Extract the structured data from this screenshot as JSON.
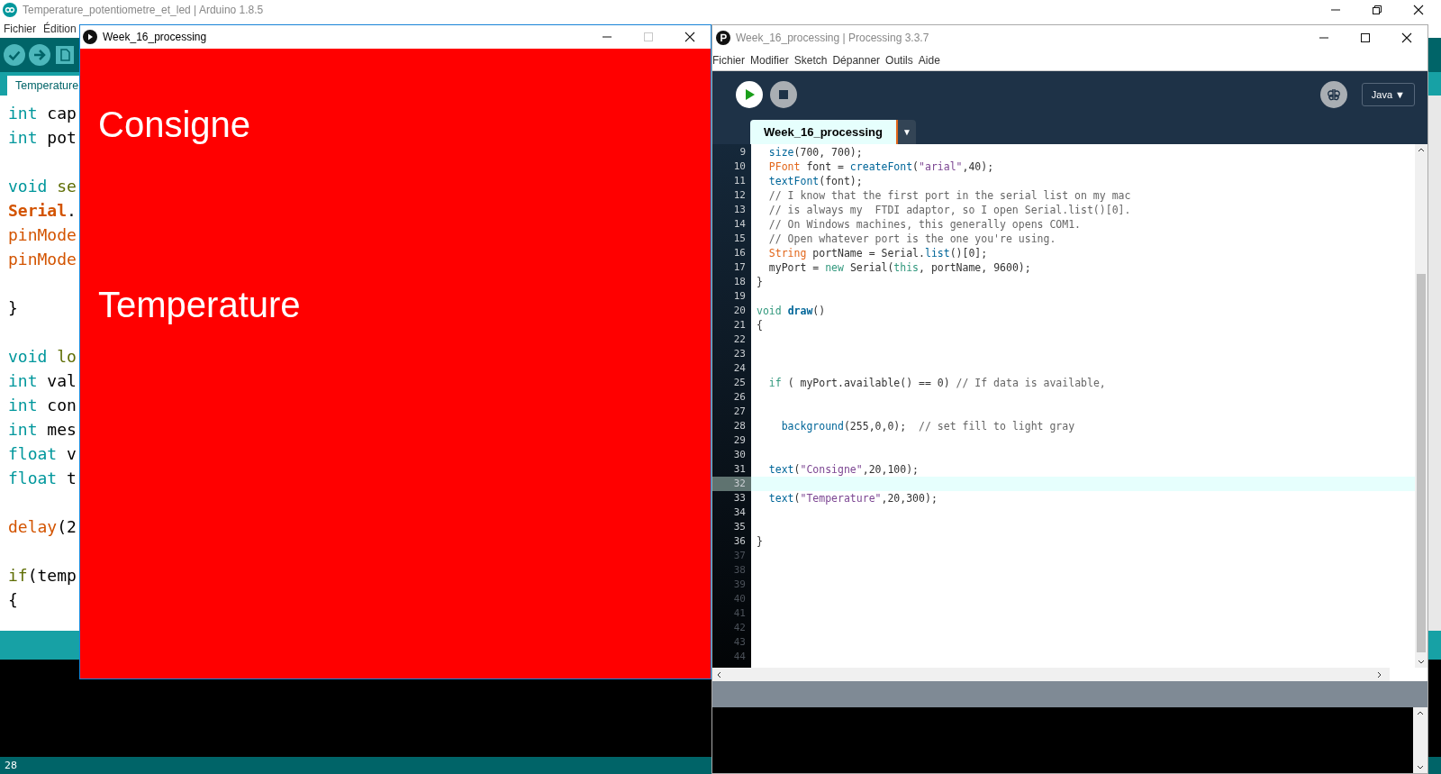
{
  "arduino": {
    "title": "Temperature_potentiometre_et_led | Arduino 1.8.5",
    "window_controls": [
      {
        "kind": "minimize",
        "disabled": false
      },
      {
        "kind": "restore",
        "disabled": false
      },
      {
        "kind": "close",
        "disabled": false
      }
    ],
    "menu": [
      "Fichier",
      "Édition"
    ],
    "tab": {
      "label": "Temperature",
      "selected": true
    },
    "code": [
      {
        "kind": "code",
        "segs": [
          {
            "t": "int",
            "kind": "type"
          },
          {
            "t": " cap",
            "kind": "plain"
          }
        ]
      },
      {
        "kind": "code",
        "segs": [
          {
            "t": "int",
            "kind": "type"
          },
          {
            "t": " pot",
            "kind": "plain"
          }
        ]
      },
      {
        "kind": "blank"
      },
      {
        "kind": "code",
        "segs": [
          {
            "t": "void ",
            "kind": "type"
          },
          {
            "t": "se",
            "kind": "fn"
          }
        ]
      },
      {
        "kind": "code",
        "segs": [
          {
            "t": "Serial",
            "kind": "class"
          },
          {
            "t": ".",
            "kind": "plain"
          }
        ]
      },
      {
        "kind": "code",
        "segs": [
          {
            "t": "pinMode",
            "kind": "builtin"
          }
        ]
      },
      {
        "kind": "code",
        "segs": [
          {
            "t": "pinMode",
            "kind": "builtin"
          }
        ]
      },
      {
        "kind": "blank"
      },
      {
        "kind": "code",
        "segs": [
          {
            "t": "}",
            "kind": "plain"
          }
        ]
      },
      {
        "kind": "blank"
      },
      {
        "kind": "code",
        "segs": [
          {
            "t": "void ",
            "kind": "type"
          },
          {
            "t": "lo",
            "kind": "fn"
          }
        ]
      },
      {
        "kind": "code",
        "segs": [
          {
            "t": "int",
            "kind": "type"
          },
          {
            "t": " val",
            "kind": "plain"
          }
        ]
      },
      {
        "kind": "code",
        "segs": [
          {
            "t": "int",
            "kind": "type"
          },
          {
            "t": " con",
            "kind": "plain"
          }
        ]
      },
      {
        "kind": "code",
        "segs": [
          {
            "t": "int",
            "kind": "type"
          },
          {
            "t": " mes",
            "kind": "plain"
          }
        ]
      },
      {
        "kind": "code",
        "segs": [
          {
            "t": "float",
            "kind": "type"
          },
          {
            "t": " v",
            "kind": "plain"
          }
        ]
      },
      {
        "kind": "code",
        "segs": [
          {
            "t": "float",
            "kind": "type"
          },
          {
            "t": " t",
            "kind": "plain"
          }
        ]
      },
      {
        "kind": "blank"
      },
      {
        "kind": "code",
        "segs": [
          {
            "t": "delay",
            "kind": "builtin"
          },
          {
            "t": "(2",
            "kind": "plain"
          }
        ]
      },
      {
        "kind": "blank"
      },
      {
        "kind": "code",
        "segs": [
          {
            "t": "if",
            "kind": "fn"
          },
          {
            "t": "(temp",
            "kind": "plain"
          }
        ]
      },
      {
        "kind": "code",
        "segs": [
          {
            "t": "{",
            "kind": "plain"
          }
        ]
      }
    ],
    "status_line": "28"
  },
  "sketch_window": {
    "title": "Week_16_processing",
    "window_controls": [
      {
        "kind": "minimize",
        "disabled": false
      },
      {
        "kind": "maximize",
        "disabled": true
      },
      {
        "kind": "close",
        "disabled": false
      }
    ],
    "canvas_texts": [
      "Consigne",
      "Temperature"
    ]
  },
  "processing": {
    "title": "Week_16_processing | Processing 3.3.7",
    "window_controls": [
      {
        "kind": "minimize",
        "disabled": false
      },
      {
        "kind": "maximize",
        "disabled": false
      },
      {
        "kind": "close",
        "disabled": false
      }
    ],
    "menu": [
      "Fichier",
      "Modifier",
      "Sketch",
      "Dépanner",
      "Outils",
      "Aide"
    ],
    "mode": "Java",
    "mode_caret": "▼",
    "tabs": [
      {
        "label": "Week_16_processing",
        "selected": true
      }
    ],
    "tab_menu": "▼",
    "lines": [
      {
        "n": "9",
        "current": false,
        "dimmed": false,
        "segs": [
          {
            "t": "  size",
            "kind": "fn"
          },
          {
            "t": "(700, 700);",
            "kind": "plain"
          }
        ]
      },
      {
        "n": "10",
        "current": false,
        "dimmed": false,
        "segs": [
          {
            "t": "  PFont",
            "kind": "type"
          },
          {
            "t": " font = ",
            "kind": "plain"
          },
          {
            "t": "createFont",
            "kind": "fn"
          },
          {
            "t": "(",
            "kind": "plain"
          },
          {
            "t": "\"arial\"",
            "kind": "string"
          },
          {
            "t": ",40);",
            "kind": "plain"
          }
        ]
      },
      {
        "n": "11",
        "current": false,
        "dimmed": false,
        "segs": [
          {
            "t": "  textFont",
            "kind": "fn"
          },
          {
            "t": "(font);",
            "kind": "plain"
          }
        ]
      },
      {
        "n": "12",
        "current": false,
        "dimmed": false,
        "segs": [
          {
            "t": "  // I know that the first port in the serial list on my mac",
            "kind": "comment"
          }
        ]
      },
      {
        "n": "13",
        "current": false,
        "dimmed": false,
        "segs": [
          {
            "t": "  // is always my  FTDI adaptor, so I open Serial.list()[0].",
            "kind": "comment"
          }
        ]
      },
      {
        "n": "14",
        "current": false,
        "dimmed": false,
        "segs": [
          {
            "t": "  // On Windows machines, this generally opens COM1.",
            "kind": "comment"
          }
        ]
      },
      {
        "n": "15",
        "current": false,
        "dimmed": false,
        "segs": [
          {
            "t": "  // Open whatever port is the one you're using.",
            "kind": "comment"
          }
        ]
      },
      {
        "n": "16",
        "current": false,
        "dimmed": false,
        "segs": [
          {
            "t": "  String",
            "kind": "type"
          },
          {
            "t": " portName = Serial.",
            "kind": "plain"
          },
          {
            "t": "list",
            "kind": "fn"
          },
          {
            "t": "()[0];",
            "kind": "plain"
          }
        ]
      },
      {
        "n": "17",
        "current": false,
        "dimmed": false,
        "segs": [
          {
            "t": "  myPort = ",
            "kind": "plain"
          },
          {
            "t": "new",
            "kind": "kw"
          },
          {
            "t": " Serial(",
            "kind": "plain"
          },
          {
            "t": "this",
            "kind": "kw"
          },
          {
            "t": ", portName, 9600);",
            "kind": "plain"
          }
        ]
      },
      {
        "n": "18",
        "current": false,
        "dimmed": false,
        "segs": [
          {
            "t": "}",
            "kind": "plain"
          }
        ]
      },
      {
        "n": "19",
        "current": false,
        "dimmed": false
      },
      {
        "n": "20",
        "current": false,
        "dimmed": false,
        "segs": [
          {
            "t": "void ",
            "kind": "kw"
          },
          {
            "t": "draw",
            "kind": "fnbold"
          },
          {
            "t": "()",
            "kind": "plain"
          }
        ]
      },
      {
        "n": "21",
        "current": false,
        "dimmed": false,
        "segs": [
          {
            "t": "{",
            "kind": "plain"
          }
        ]
      },
      {
        "n": "22",
        "current": false,
        "dimmed": false
      },
      {
        "n": "23",
        "current": false,
        "dimmed": false
      },
      {
        "n": "24",
        "current": false,
        "dimmed": false
      },
      {
        "n": "25",
        "current": false,
        "dimmed": false,
        "segs": [
          {
            "t": "  if",
            "kind": "kw"
          },
          {
            "t": " ( myPort.available() == 0) ",
            "kind": "plain"
          },
          {
            "t": "// If data is available,",
            "kind": "comment"
          }
        ]
      },
      {
        "n": "26",
        "current": false,
        "dimmed": false
      },
      {
        "n": "27",
        "current": false,
        "dimmed": false
      },
      {
        "n": "28",
        "current": false,
        "dimmed": false,
        "segs": [
          {
            "t": "    background",
            "kind": "fn"
          },
          {
            "t": "(255,0,0);  ",
            "kind": "plain"
          },
          {
            "t": "// set fill to light gray",
            "kind": "comment"
          }
        ]
      },
      {
        "n": "29",
        "current": false,
        "dimmed": false
      },
      {
        "n": "30",
        "current": false,
        "dimmed": false
      },
      {
        "n": "31",
        "current": false,
        "dimmed": false,
        "segs": [
          {
            "t": "  text",
            "kind": "fn"
          },
          {
            "t": "(",
            "kind": "plain"
          },
          {
            "t": "\"Consigne\"",
            "kind": "string"
          },
          {
            "t": ",20,100);",
            "kind": "plain"
          }
        ]
      },
      {
        "n": "32",
        "current": true,
        "dimmed": false
      },
      {
        "n": "33",
        "current": false,
        "dimmed": false,
        "segs": [
          {
            "t": "  text",
            "kind": "fn"
          },
          {
            "t": "(",
            "kind": "plain"
          },
          {
            "t": "\"Temperature\"",
            "kind": "string"
          },
          {
            "t": ",20,300);",
            "kind": "plain"
          }
        ]
      },
      {
        "n": "34",
        "current": false,
        "dimmed": false
      },
      {
        "n": "35",
        "current": false,
        "dimmed": false
      },
      {
        "n": "36",
        "current": false,
        "dimmed": false,
        "segs": [
          {
            "t": "}",
            "kind": "plain"
          }
        ]
      },
      {
        "n": "37",
        "current": false,
        "dimmed": true
      },
      {
        "n": "38",
        "current": false,
        "dimmed": true
      },
      {
        "n": "39",
        "current": false,
        "dimmed": true
      },
      {
        "n": "40",
        "current": false,
        "dimmed": true
      },
      {
        "n": "41",
        "current": false,
        "dimmed": true
      },
      {
        "n": "42",
        "current": false,
        "dimmed": true
      },
      {
        "n": "43",
        "current": false,
        "dimmed": true
      },
      {
        "n": "44",
        "current": false,
        "dimmed": true
      }
    ]
  }
}
